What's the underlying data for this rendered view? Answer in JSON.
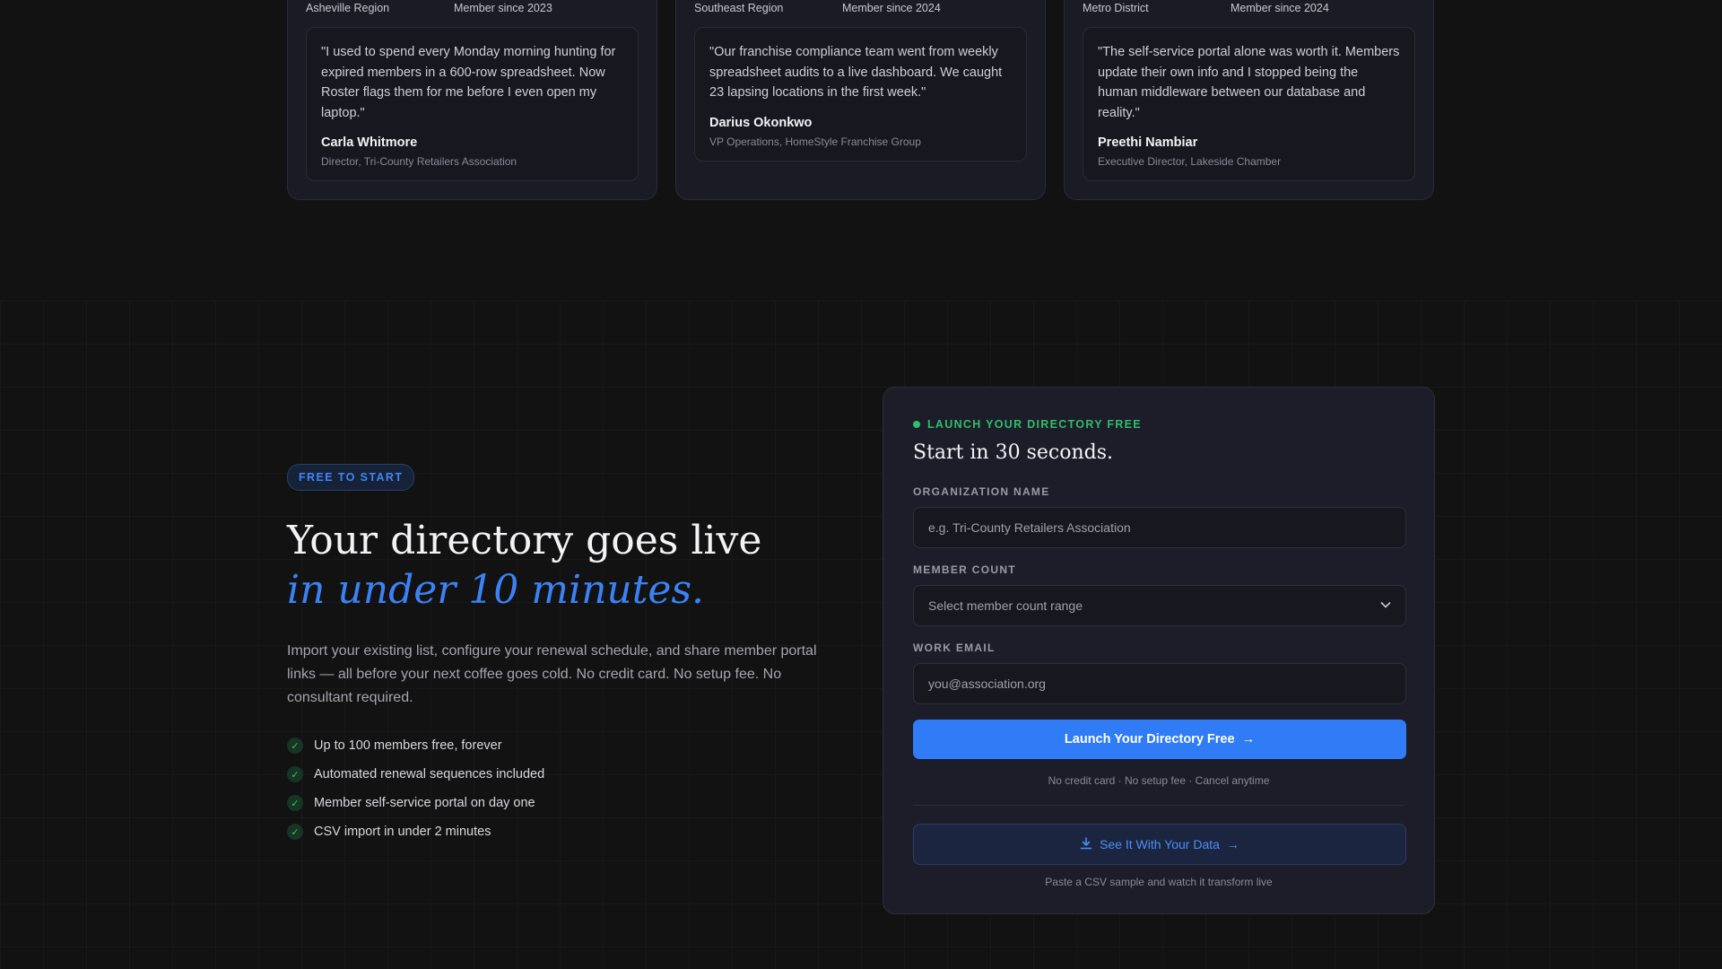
{
  "testimonials": [
    {
      "region": "Asheville Region",
      "member_since": "Member since 2023",
      "quote": "\"I used to spend every Monday morning hunting for expired members in a 600-row spreadsheet. Now Roster flags them for me before I even open my laptop.\"",
      "name": "Carla Whitmore",
      "role": "Director, Tri-County Retailers Association"
    },
    {
      "region": "Southeast Region",
      "member_since": "Member since 2024",
      "quote": "\"Our franchise compliance team went from weekly spreadsheet audits to a live dashboard. We caught 23 lapsing locations in the first week.\"",
      "name": "Darius Okonkwo",
      "role": "VP Operations, HomeStyle Franchise Group"
    },
    {
      "region": "Metro District",
      "member_since": "Member since 2024",
      "quote": "\"The self-service portal alone was worth it. Members update their own info and I stopped being the human middleware between our database and reality.\"",
      "name": "Preethi Nambiar",
      "role": "Executive Director, Lakeside Chamber"
    }
  ],
  "cta": {
    "badge": "FREE TO START",
    "headline_line1": "Your directory goes live",
    "headline_line2": "in under 10 minutes.",
    "description": "Import your existing list, configure your renewal schedule, and share member portal links — all before your next coffee goes cold. No credit card. No setup fee. No consultant required.",
    "checklist": [
      "Up to 100 members free, forever",
      "Automated renewal sequences included",
      "Member self-service portal on day one",
      "CSV import in under 2 minutes"
    ]
  },
  "form": {
    "eyebrow": "LAUNCH YOUR DIRECTORY FREE",
    "title": "Start in 30 seconds.",
    "org_label": "ORGANIZATION NAME",
    "org_placeholder": "e.g. Tri-County Retailers Association",
    "count_label": "MEMBER COUNT",
    "count_selected": "Select member count range",
    "email_label": "WORK EMAIL",
    "email_placeholder": "you@association.org",
    "primary_button": "Launch Your Directory Free",
    "primary_arrow": "→",
    "fine_print": "No credit card · No setup fee · Cancel anytime",
    "secondary_button": "See It With Your Data",
    "secondary_arrow": "→",
    "secondary_note": "Paste a CSV sample and watch it transform live"
  },
  "colors": {
    "accent": "#3b82f6",
    "success": "#2fbe6a",
    "background": "#121212"
  },
  "icons": {
    "check": "check-icon",
    "download": "download-icon",
    "status_dot": "status-dot-icon"
  }
}
